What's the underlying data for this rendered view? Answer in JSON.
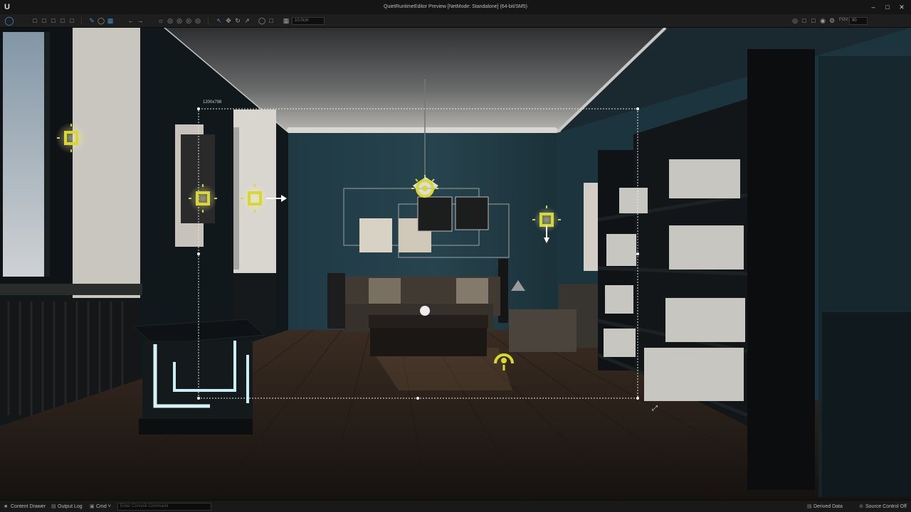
{
  "window": {
    "title": "QuietRuntimeEditor Preview [NetMode: Standalone]  (64-bit/SM5)",
    "logo": "U",
    "controls": [
      "minimize-icon",
      "maximize-icon",
      "close-icon"
    ]
  },
  "toolbar": {
    "snap_value": "10.0cm",
    "fov_label": "FOV:",
    "fov_value": "90"
  },
  "viewport": {
    "resolution_label": "1200x798"
  },
  "statusbar": {
    "content_drawer": "Content Drawer",
    "output_log": "Output Log",
    "cmd": "Cmd",
    "console_placeholder": "Enter Console Command",
    "derived_data": "Derived Data",
    "source_control": "Source Control Off"
  },
  "colors": {
    "accent": "#3f8fd0",
    "light_gizmo": "#d8d830",
    "wall": "#1f3a44"
  }
}
